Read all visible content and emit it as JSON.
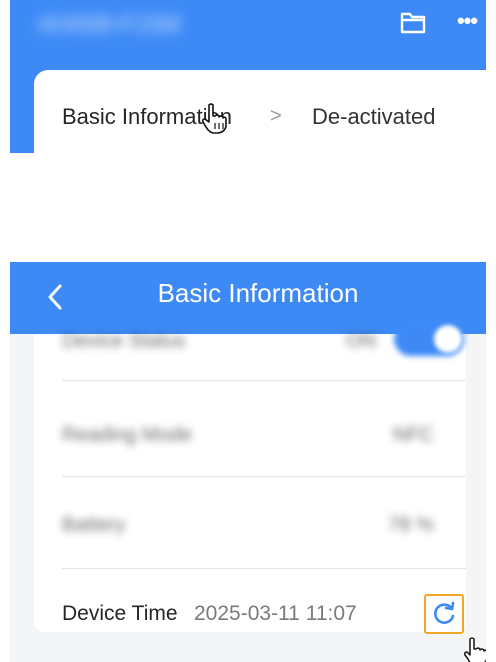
{
  "top_panel": {
    "header_title": "AH008-F15M",
    "icons": {
      "folder": "folder-icon",
      "more": "more-icon"
    },
    "card": {
      "label": "Basic Information",
      "chevron": ">",
      "status": "De-activated"
    },
    "cursor": "pointer-hand-icon"
  },
  "bottom_panel": {
    "nav": {
      "back_icon": "chevron-left-icon",
      "title": "Basic Information"
    },
    "rows": [
      {
        "label": "Device Status",
        "value": "ON"
      },
      {
        "label": "Reading Mode",
        "value": "NFC"
      },
      {
        "label": "Battery",
        "value": "78 %"
      }
    ],
    "device_time": {
      "label": "Device Time",
      "value": "2025-03-11 11:07",
      "refresh_icon": "refresh-icon"
    },
    "cursor": "pointer-hand-icon"
  },
  "colors": {
    "brand_blue": "#3d8af7",
    "highlight_orange": "#f0a623",
    "background": "#f4f5f7"
  }
}
